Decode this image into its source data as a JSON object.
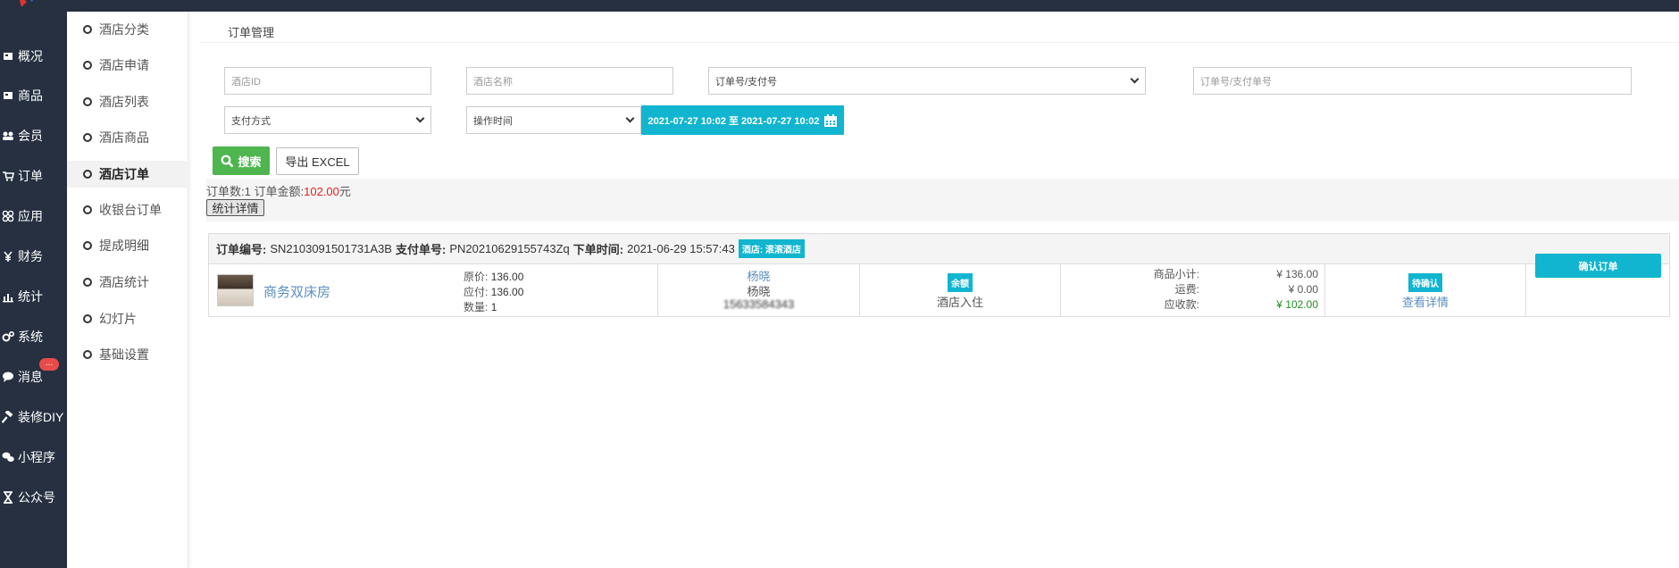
{
  "nav": {
    "items": [
      {
        "label": "概况",
        "icon": "dashboard-icon"
      },
      {
        "label": "商品",
        "icon": "goods-icon"
      },
      {
        "label": "会员",
        "icon": "members-icon"
      },
      {
        "label": "订单",
        "icon": "cart-icon"
      },
      {
        "label": "应用",
        "icon": "apps-icon"
      },
      {
        "label": "财务",
        "icon": "yen-icon"
      },
      {
        "label": "统计",
        "icon": "bar-chart-icon"
      },
      {
        "label": "系统",
        "icon": "gears-icon"
      },
      {
        "label": "消息",
        "icon": "comment-icon"
      },
      {
        "label": "装修DIY",
        "icon": "hammer-icon"
      },
      {
        "label": "小程序",
        "icon": "wechat-icon"
      },
      {
        "label": "公众号",
        "icon": "hourglass-icon"
      }
    ],
    "message_badge": "..."
  },
  "subnav": {
    "items": [
      {
        "label": "酒店分类"
      },
      {
        "label": "酒店申请"
      },
      {
        "label": "酒店列表"
      },
      {
        "label": "酒店商品"
      },
      {
        "label": "酒店订单",
        "active": true
      },
      {
        "label": "收银台订单"
      },
      {
        "label": "提成明细"
      },
      {
        "label": "酒店统计"
      },
      {
        "label": "幻灯片"
      },
      {
        "label": "基础设置"
      }
    ]
  },
  "breadcrumb": {
    "title": "订单管理"
  },
  "filters": {
    "hotel_id_placeholder": "酒店ID",
    "hotel_name_placeholder": "酒店名称",
    "order_type_select": "订单号/支付号",
    "order_no_placeholder": "订单号/支付单号",
    "pay_method_select": "支付方式",
    "time_type_select": "操作时间",
    "date_range": "2021-07-27 10:02 至 2021-07-27 10:02",
    "search_label": "搜索",
    "export_label": "导出 EXCEL"
  },
  "summary": {
    "count_label": "订单数:",
    "count": "1",
    "amount_label": "订单金额:",
    "amount": "102.00",
    "amount_unit": "元",
    "stats_button": "统计详情"
  },
  "order": {
    "no_label": "订单编号:",
    "no": "SN2103091501731A3B",
    "pay_no_label": "支付单号:",
    "pay_no": "PN20210629155743Zq",
    "time_label": "下单时间:",
    "time": "2021-06-29 15:57:43",
    "hotel_tag": "酒店: 滚滚酒店",
    "product_name": "商务双床房",
    "orig_price_label": "原价:",
    "orig_price": "136.00",
    "pay_price_label": "应付:",
    "pay_price": "136.00",
    "qty_label": "数量:",
    "qty": "1",
    "buyer_name": "杨晓",
    "contact_name": "杨晓",
    "phone_masked": "15633584343",
    "pay_type_tag": "余额",
    "delivery_type": "酒店入住",
    "subtotal_label": "商品小计:",
    "subtotal": "¥ 136.00",
    "shipping_label": "运费:",
    "shipping": "¥ 0.00",
    "receivable_label": "应收款:",
    "receivable": "¥ 102.00",
    "status_tag": "待确认",
    "detail_link": "查看详情",
    "confirm_button": "确认订单"
  },
  "colors": {
    "nav_bg": "#263040",
    "accent": "#11b5cf",
    "search_green": "#4fb54f",
    "amount_red": "#e02020",
    "receivable_green": "#1e8f1e",
    "badge_red": "#e94b4b"
  }
}
